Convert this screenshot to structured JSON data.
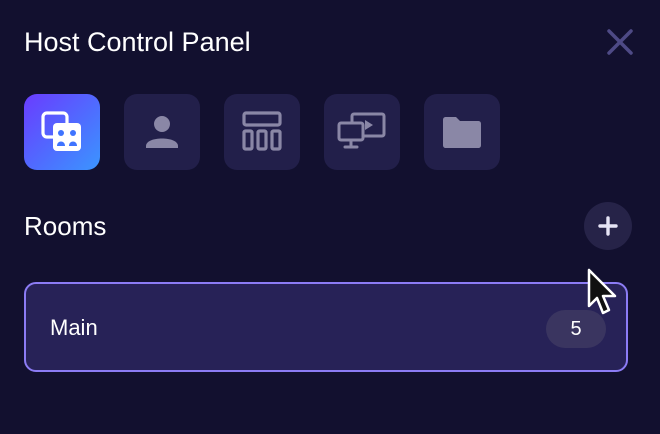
{
  "panel": {
    "title": "Host Control Panel"
  },
  "toolbar": {
    "tools": [
      {
        "name": "rooms",
        "icon": "rooms-icon",
        "active": true
      },
      {
        "name": "participants",
        "icon": "user-icon",
        "active": false
      },
      {
        "name": "layout",
        "icon": "layout-icon",
        "active": false
      },
      {
        "name": "screen-share",
        "icon": "screen-share-icon",
        "active": false
      },
      {
        "name": "files",
        "icon": "folder-icon",
        "active": false
      }
    ]
  },
  "rooms": {
    "heading": "Rooms",
    "items": [
      {
        "name": "Main",
        "count": "5"
      }
    ]
  },
  "colors": {
    "background": "#12102f",
    "tile": "#221f4a",
    "active_gradient_start": "#6a3cff",
    "active_gradient_end": "#3b95ff",
    "room_border": "#8c7cf5",
    "room_fill": "#272257",
    "icon_gray": "#8a87a6",
    "close_icon": "#4e4a86"
  }
}
